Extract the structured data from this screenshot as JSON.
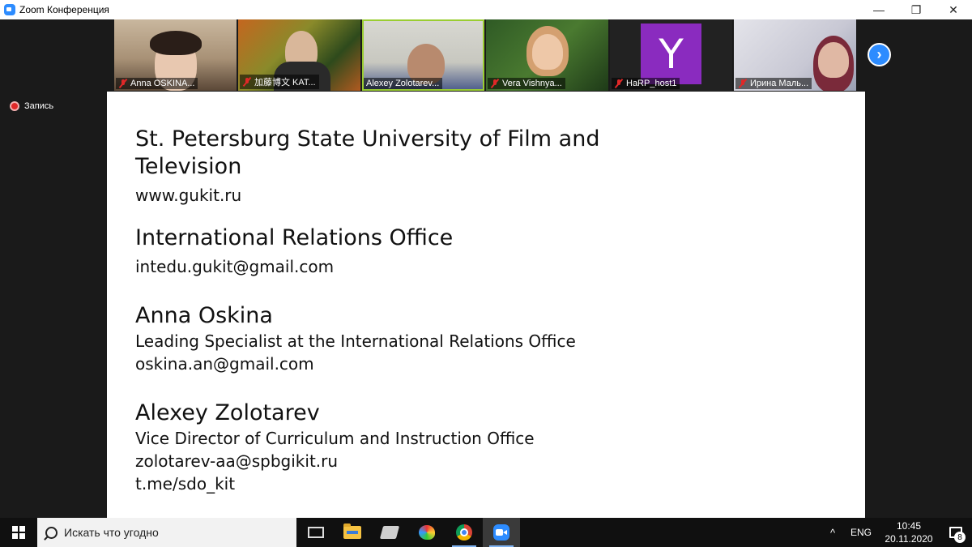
{
  "window": {
    "title": "Zoom Конференция",
    "minimize_glyph": "—",
    "restore_glyph": "❐",
    "close_glyph": "✕"
  },
  "participants": [
    {
      "name": "Anna OSKINA...",
      "muted": true
    },
    {
      "name": "加藤博文 KAT...",
      "muted": true
    },
    {
      "name": "Alexey Zolotarev...",
      "muted": false,
      "active_speaker": true
    },
    {
      "name": "Vera Vishnya...",
      "muted": true
    },
    {
      "name": "HaRP_host1",
      "muted": true,
      "avatar_letter": "Y",
      "avatar_color": "#8a2bbf"
    },
    {
      "name": "Ирина Маль...",
      "muted": true
    }
  ],
  "next_page_glyph": "›",
  "recording": {
    "label": "Запись"
  },
  "slide": {
    "university": "St. Petersburg State University of Film and Television",
    "website": "www.gukit.ru",
    "office_title": "International Relations Office",
    "office_email": "intedu.gukit@gmail.com",
    "contact1": {
      "name": "Anna Oskina",
      "role": "Leading Specialist at the International Relations Office",
      "email": "oskina.an@gmail.com"
    },
    "contact2": {
      "name": "Alexey Zolotarev",
      "role": "Vice Director of Curriculum and Instruction Office",
      "email": "zolotarev-aa@spbgikit.ru",
      "telegram": "t.me/sdo_kit"
    }
  },
  "taskbar": {
    "search_placeholder": "Искать что угодно",
    "language": "ENG",
    "time": "10:45",
    "date": "20.11.2020",
    "notification_count": "8",
    "tray_chevron": "^"
  },
  "colors": {
    "zoom_blue": "#2d8cff",
    "muted_red": "#e02828",
    "active_speaker_border": "#9acd32"
  }
}
